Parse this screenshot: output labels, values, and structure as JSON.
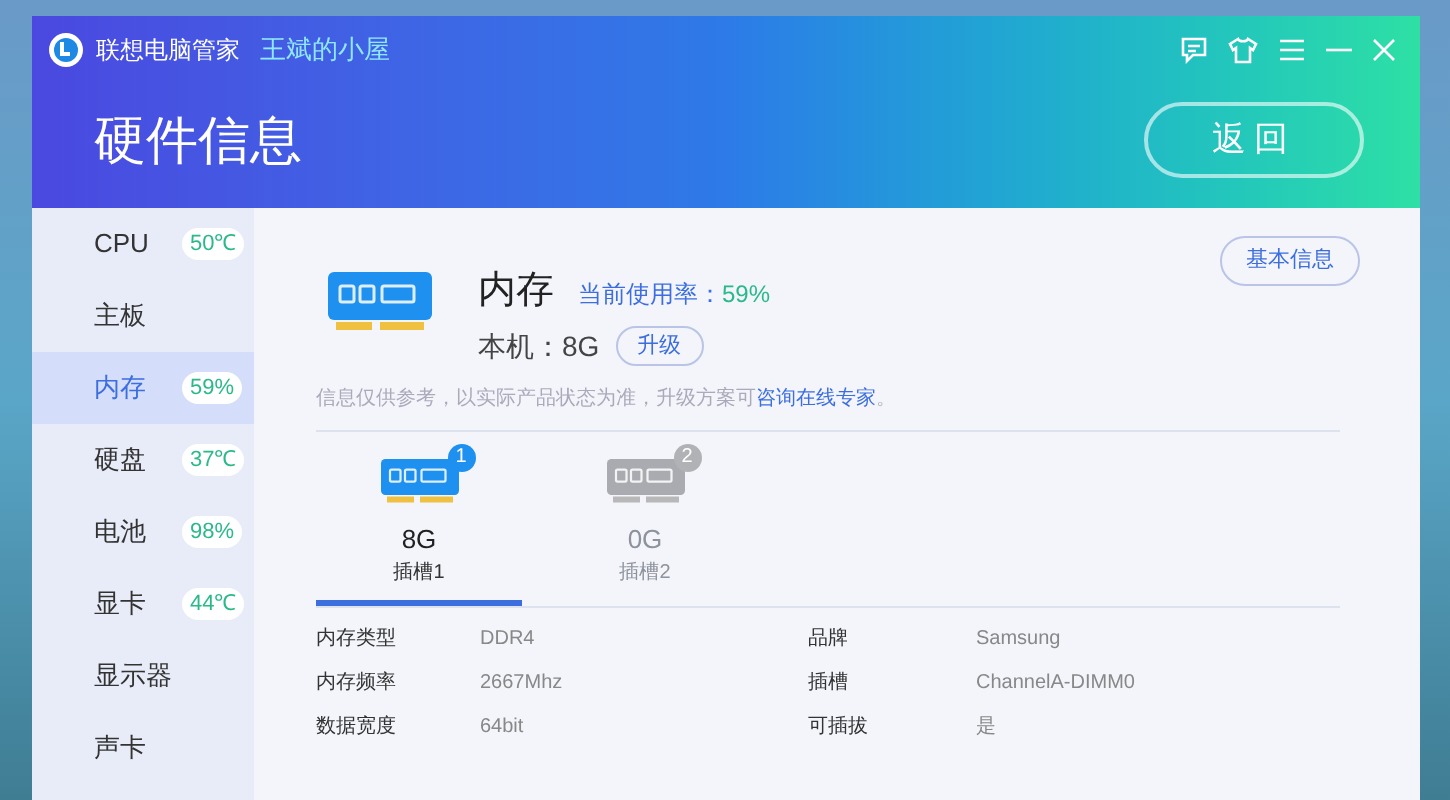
{
  "window": {
    "app_name": "联想电脑管家",
    "user_name": "王斌的小屋",
    "title": "硬件信息",
    "back_button": "返回"
  },
  "sidebar": {
    "items": [
      {
        "label": "CPU",
        "badge": "50℃",
        "selected": false
      },
      {
        "label": "主板",
        "selected": false
      },
      {
        "label": "内存",
        "badge": "59%",
        "selected": true
      },
      {
        "label": "硬盘",
        "badge": "37℃",
        "selected": false
      },
      {
        "label": "电池",
        "badge": "98%",
        "selected": false
      },
      {
        "label": "显卡",
        "badge": "44℃",
        "selected": false
      },
      {
        "label": "显示器",
        "selected": false
      },
      {
        "label": "声卡",
        "selected": false
      }
    ]
  },
  "summary": {
    "name": "内存",
    "usage_label": "当前使用率：",
    "usage_value": "59%",
    "capacity": "本机：8G",
    "upgrade_button": "升级",
    "basic_info_button": "基本信息",
    "note": "信息仅供参考，以实际产品状态为准，升级方案可",
    "note_link": "咨询在线专家",
    "note_end": "。"
  },
  "slots": [
    {
      "badge": "1",
      "size": "8G",
      "label": "插槽1",
      "selected": true
    },
    {
      "badge": "2",
      "size": "0G",
      "label": "插槽2",
      "selected": false
    }
  ],
  "details": [
    {
      "label": "内存类型",
      "value": "DDR4",
      "label_2": "品牌",
      "value_2": "Samsung"
    },
    {
      "label": "内存频率",
      "value": "2667Mhz",
      "label_2": "插槽",
      "value_2": "ChannelA-DIMM0"
    },
    {
      "label": "数据宽度",
      "value": "64bit",
      "label_2": "可插拔",
      "value_2": "是"
    }
  ]
}
